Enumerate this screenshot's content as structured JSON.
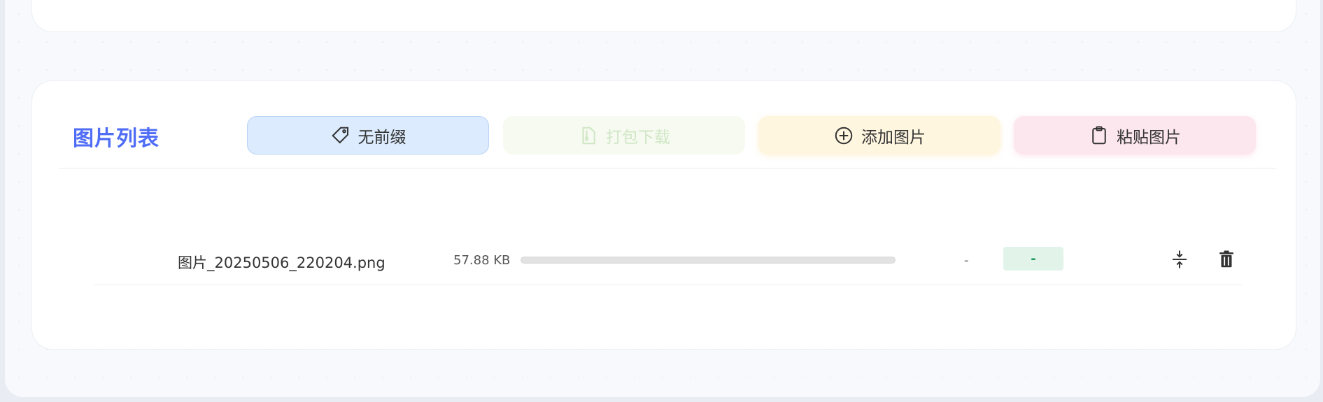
{
  "list": {
    "title": "图片列表",
    "toolbar": {
      "prefix_label": "无前缀",
      "zip_label": "打包下载",
      "add_label": "添加图片",
      "paste_label": "粘贴图片"
    },
    "files": [
      {
        "name": "图片_20250506_220204.png",
        "size": "57.88 KB",
        "progress_percent": 0,
        "result": "-",
        "badge": "-"
      }
    ]
  },
  "icons": {
    "prefix": "tag-icon",
    "zip": "zip-file-icon",
    "add": "plus-circle-icon",
    "paste": "clipboard-icon",
    "compress": "compress-icon",
    "delete": "trash-icon"
  },
  "colors": {
    "title": "#4f6df5",
    "badge_text": "#1e9b5a"
  }
}
